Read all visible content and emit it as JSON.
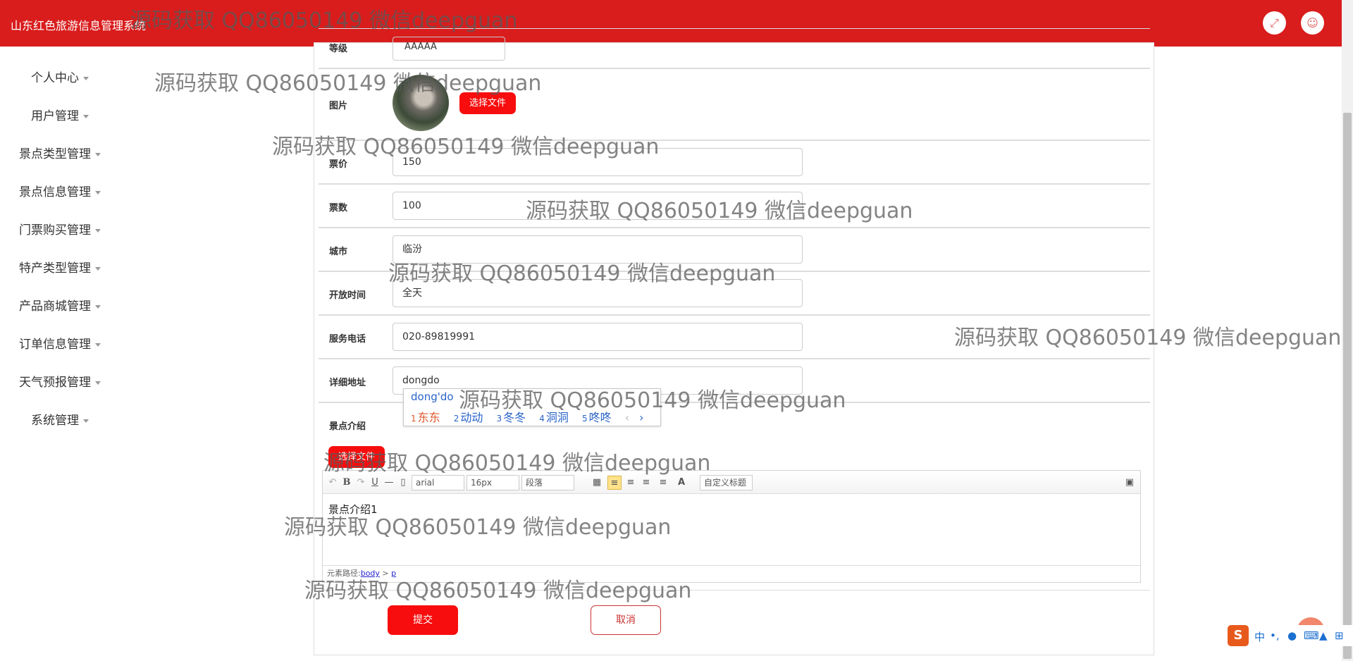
{
  "app": {
    "title": "山东红色旅游信息管理系统"
  },
  "topbar": {
    "fullscreen_icon": "expand-icon",
    "user_icon": "user-icon"
  },
  "sidebar": {
    "items": [
      {
        "label": "个人中心"
      },
      {
        "label": "用户管理"
      },
      {
        "label": "景点类型管理"
      },
      {
        "label": "景点信息管理"
      },
      {
        "label": "门票购买管理"
      },
      {
        "label": "特产类型管理"
      },
      {
        "label": "产品商城管理"
      },
      {
        "label": "订单信息管理"
      },
      {
        "label": "天气预报管理"
      },
      {
        "label": "系统管理"
      }
    ]
  },
  "form": {
    "level": {
      "label": "等级",
      "value": "AAAAA"
    },
    "image": {
      "label": "图片",
      "button": "选择文件"
    },
    "price": {
      "label": "票价",
      "value": "150"
    },
    "tickets": {
      "label": "票数",
      "value": "100"
    },
    "city": {
      "label": "城市",
      "value": "临汾"
    },
    "open_time": {
      "label": "开放时间",
      "value": "全天"
    },
    "phone": {
      "label": "服务电话",
      "value": "020-89819991"
    },
    "address": {
      "label": "详细地址",
      "value": "dongdo"
    },
    "intro": {
      "label": "景点介绍",
      "button": "选择文件",
      "content": "景点介绍1"
    }
  },
  "ime": {
    "pinyin": "dong'do",
    "candidates": [
      {
        "n": "1",
        "text": "东东"
      },
      {
        "n": "2",
        "text": "动动"
      },
      {
        "n": "3",
        "text": "冬冬"
      },
      {
        "n": "4",
        "text": "洞洞"
      },
      {
        "n": "5",
        "text": "咚咚"
      }
    ],
    "prev": "‹",
    "next": "›"
  },
  "editor": {
    "font": "arial",
    "size": "16px",
    "paragraph": "段落",
    "custom_title": "自定义标题",
    "path_label": "元素路径:",
    "path_body": "body",
    "path_sep": " > ",
    "path_p": "p",
    "tools": {
      "bold": "B",
      "underline": "U",
      "hr": "—",
      "font_color": "A"
    }
  },
  "actions": {
    "submit": "提交",
    "cancel": "取消"
  },
  "watermark": "源码获取 QQ86050149 微信deepguan",
  "tray": {
    "logo": "S",
    "mode": "中",
    "punct": "•,",
    "mic": "🎤",
    "keyboard": "⌨",
    "skin": "👕",
    "grid": "⊞"
  }
}
